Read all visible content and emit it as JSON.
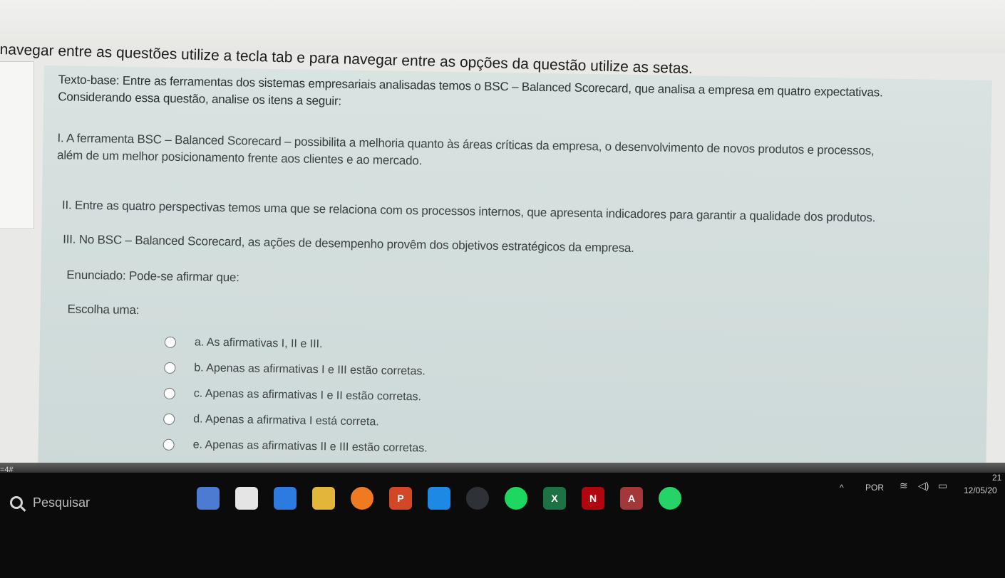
{
  "instruction": "navegar entre as questões utilize a tecla tab e para navegar entre as opções da questão utilize as setas.",
  "question": {
    "texto_base_line1": "Texto-base: Entre as ferramentas dos sistemas empresariais analisadas temos o BSC – Balanced Scorecard, que analisa a empresa em quatro expectativas.",
    "texto_base_line2": "Considerando essa questão, analise os itens a seguir:",
    "item1_line1": "I. A ferramenta BSC – Balanced Scorecard – possibilita a melhoria quanto às áreas críticas da empresa, o desenvolvimento de novos produtos e processos,",
    "item1_line2": "além de um melhor posicionamento frente aos clientes e ao mercado.",
    "item2": "II. Entre as quatro perspectivas temos uma que se relaciona com os processos internos, que apresenta indicadores para garantir a qualidade dos produtos.",
    "item3": "III. No BSC – Balanced Scorecard, as ações de desempenho provêm dos objetivos estratégicos da empresa.",
    "enunciado": "Enunciado: Pode-se afirmar que:",
    "escolha": "Escolha uma:",
    "options": [
      "a. As afirmativas I, II e III.",
      "b. Apenas as afirmativas I e III estão corretas.",
      "c. Apenas as afirmativas I e II estão corretas.",
      "d. Apenas a afirmativa I está correta.",
      "e. Apenas as afirmativas II e III estão corretas."
    ]
  },
  "taskbar": {
    "search_label": "Pesquisar",
    "corner_label": "=4#",
    "language": "POR",
    "date": "12/05/20",
    "time": "21",
    "apps": [
      {
        "name": "widgets",
        "color": "#4c7bd1",
        "glyph": ""
      },
      {
        "name": "explorer-window",
        "color": "#e5e5e5",
        "glyph": ""
      },
      {
        "name": "copilot",
        "color": "#2d7be0",
        "glyph": ""
      },
      {
        "name": "file-explorer",
        "color": "#e3b53a",
        "glyph": ""
      },
      {
        "name": "firefox",
        "color": "#f07a22",
        "glyph": ""
      },
      {
        "name": "powerpoint",
        "color": "#d24726",
        "glyph": "P"
      },
      {
        "name": "vscode",
        "color": "#1e88e5",
        "glyph": ""
      },
      {
        "name": "github",
        "color": "#2e3137",
        "glyph": ""
      },
      {
        "name": "spotify",
        "color": "#1ed760",
        "glyph": ""
      },
      {
        "name": "excel",
        "color": "#1d7245",
        "glyph": "X"
      },
      {
        "name": "netflix",
        "color": "#b0060f",
        "glyph": "N"
      },
      {
        "name": "access",
        "color": "#a4373a",
        "glyph": "A"
      },
      {
        "name": "whatsapp",
        "color": "#25d366",
        "glyph": ""
      }
    ]
  }
}
